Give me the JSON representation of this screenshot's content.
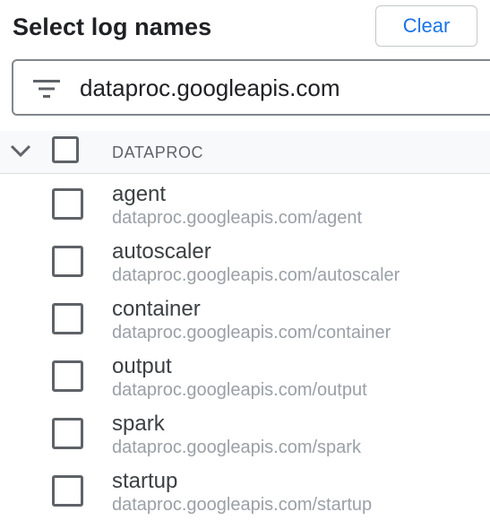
{
  "header": {
    "title": "Select log names",
    "clear_label": "Clear"
  },
  "filter": {
    "value": "dataproc.googleapis.com",
    "icon": "filter-icon"
  },
  "group": {
    "label": "DATAPROC",
    "expanded": true,
    "checked": false
  },
  "items": [
    {
      "name": "agent",
      "path": "dataproc.googleapis.com/agent",
      "checked": false
    },
    {
      "name": "autoscaler",
      "path": "dataproc.googleapis.com/autoscaler",
      "checked": false
    },
    {
      "name": "container",
      "path": "dataproc.googleapis.com/container",
      "checked": false
    },
    {
      "name": "output",
      "path": "dataproc.googleapis.com/output",
      "checked": false
    },
    {
      "name": "spark",
      "path": "dataproc.googleapis.com/spark",
      "checked": false
    },
    {
      "name": "startup",
      "path": "dataproc.googleapis.com/startup",
      "checked": false
    }
  ],
  "colors": {
    "accent": "#1a73e8",
    "text": "#202124",
    "secondary_text": "#9aa0a6",
    "border": "#80868b"
  }
}
